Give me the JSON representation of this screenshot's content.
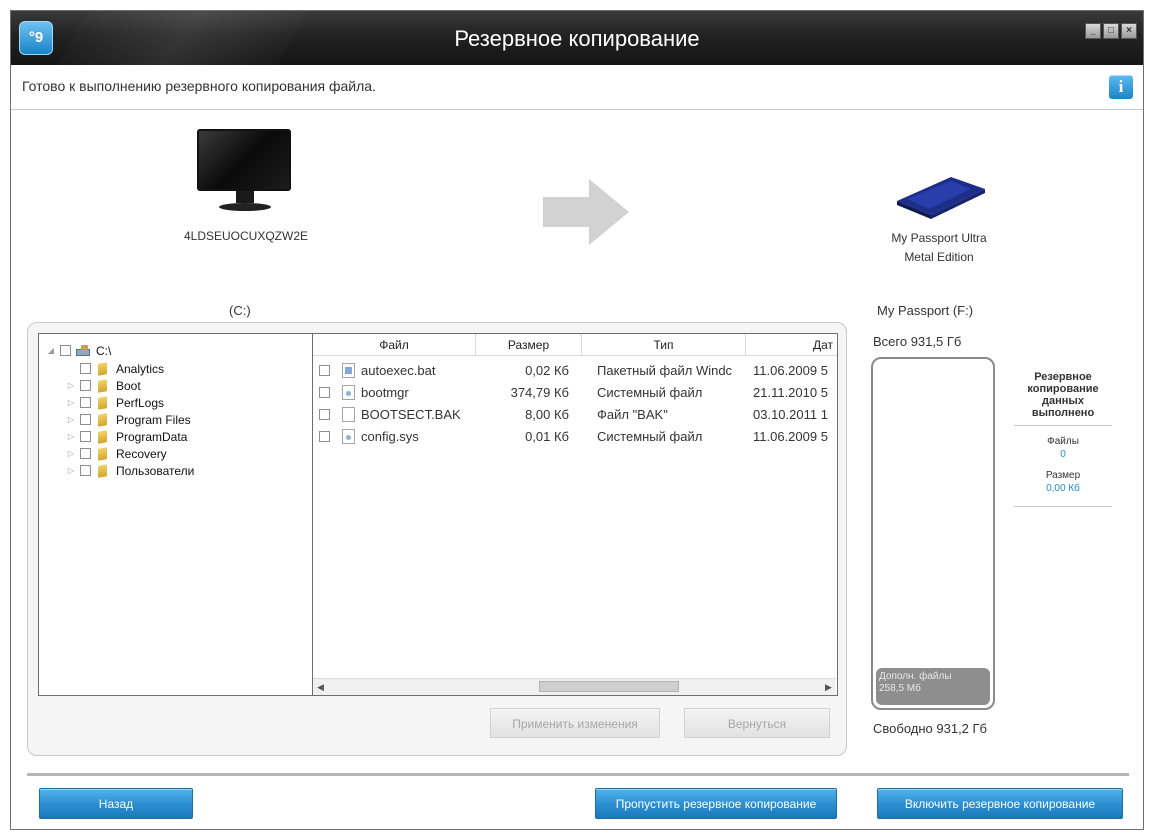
{
  "window": {
    "title": "Резервное копирование",
    "controls": [
      "_",
      "□",
      "×"
    ],
    "accent": "#2d90d3"
  },
  "status": {
    "text": "Готово к выполнению резервного копирования файла.",
    "info_icon": "i"
  },
  "source": {
    "computer_name": "4LDSEUOCUXQZW2E",
    "drive_label": "(C:)"
  },
  "destination": {
    "device_line1": "My Passport Ultra",
    "device_line2": "Metal Edition",
    "drive_label": "My Passport (F:)"
  },
  "tree": {
    "root": "C:\\",
    "items": [
      "Analytics",
      "Boot",
      "PerfLogs",
      "Program Files",
      "ProgramData",
      "Recovery",
      "Пользователи"
    ]
  },
  "file_list": {
    "columns": [
      "Файл",
      "Размер",
      "Тип",
      "Дат"
    ],
    "rows": [
      {
        "name": "autoexec.bat",
        "size": "0,02 Кб",
        "type": "Пакетный файл Windc",
        "date": "11.06.2009 5"
      },
      {
        "name": "bootmgr",
        "size": "374,79 Кб",
        "type": "Системный файл",
        "date": "21.11.2010 5"
      },
      {
        "name": "BOOTSECT.BAK",
        "size": "8,00 Кб",
        "type": "Файл \"BAK\"",
        "date": "03.10.2011 1"
      },
      {
        "name": "config.sys",
        "size": "0,01 Кб",
        "type": "Системный файл",
        "date": "11.06.2009 5"
      }
    ]
  },
  "panel_buttons": {
    "apply": "Применить изменения",
    "revert": "Вернуться"
  },
  "capacity": {
    "total": "Всего 931,5 Гб",
    "free": "Свободно 931,2 Гб",
    "extra_files_label": "Дополн. файлы",
    "extra_files_size": "258,5 Мб"
  },
  "backup_summary": {
    "title_lines": [
      "Резервное",
      "копирование",
      "данных",
      "выполнено"
    ],
    "files_label": "Файлы",
    "files_value": "0",
    "size_label": "Размер",
    "size_value": "0,00 Кб"
  },
  "footer": {
    "back": "Назад",
    "skip": "Пропустить резервное копирование",
    "enable": "Включить резервное копирование"
  }
}
